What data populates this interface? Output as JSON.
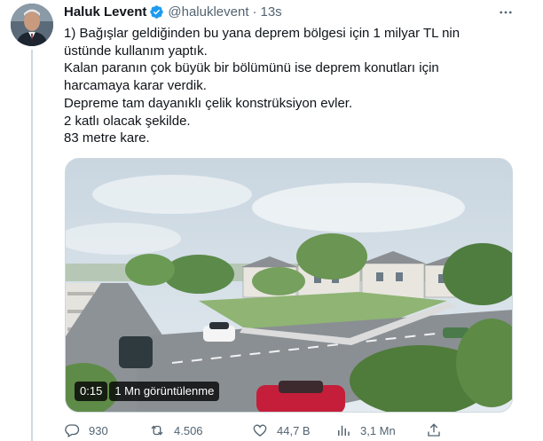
{
  "tweet": {
    "display_name": "Haluk Levent",
    "handle": "@haluklevent",
    "separator": "·",
    "time": "13s",
    "body_lines": [
      "1) Bağışlar geldiğinden bu yana deprem bölgesi için 1 milyar TL nin",
      "üstünde kullanım yaptık.",
      "Kalan paranın çok büyük bir bölümünü ise deprem konutları için",
      "harcamaya karar verdik.",
      "Depreme tam dayanıklı çelik konstrüksiyon evler.",
      "2 katlı olacak şekilde.",
      "83 metre kare."
    ],
    "video": {
      "duration": "0:15",
      "views": "1 Mn görüntülenme"
    },
    "actions": {
      "replies": "930",
      "retweets": "4.506",
      "likes": "44,7 B",
      "views": "3,1 Mn"
    }
  },
  "icons": {
    "verified": "verified-badge-icon",
    "more": "more-dots-icon",
    "reply": "reply-icon",
    "retweet": "retweet-icon",
    "like": "heart-icon",
    "views": "bar-chart-icon",
    "share": "share-icon"
  },
  "colors": {
    "text_primary": "#0f1419",
    "text_secondary": "#536471",
    "verified_blue": "#1d9bf0",
    "border": "#cfd9de"
  }
}
